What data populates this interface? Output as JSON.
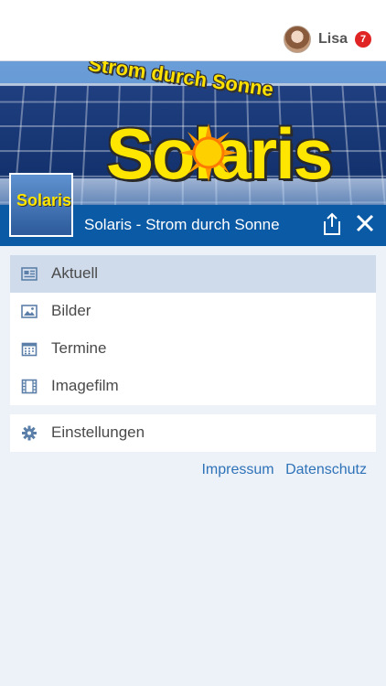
{
  "header": {
    "user_name": "Lisa",
    "notification_count": "7"
  },
  "banner": {
    "tagline": "Strom durch Sonne",
    "logo_text": "Solaris",
    "thumb_text": "Solaris",
    "title": "Solaris - Strom durch Sonne"
  },
  "menu": {
    "items": [
      {
        "label": "Aktuell",
        "icon": "news-icon",
        "active": true
      },
      {
        "label": "Bilder",
        "icon": "image-icon",
        "active": false
      },
      {
        "label": "Termine",
        "icon": "calendar-icon",
        "active": false
      },
      {
        "label": "Imagefilm",
        "icon": "film-icon",
        "active": false
      }
    ]
  },
  "settings": {
    "label": "Einstellungen",
    "icon": "gear-icon"
  },
  "footer_links": {
    "impressum": "Impressum",
    "datenschutz": "Datenschutz"
  },
  "colors": {
    "accent": "#0b5aa5",
    "active_bg": "#cfdbeb",
    "link": "#2e73b8",
    "badge": "#e02424"
  }
}
